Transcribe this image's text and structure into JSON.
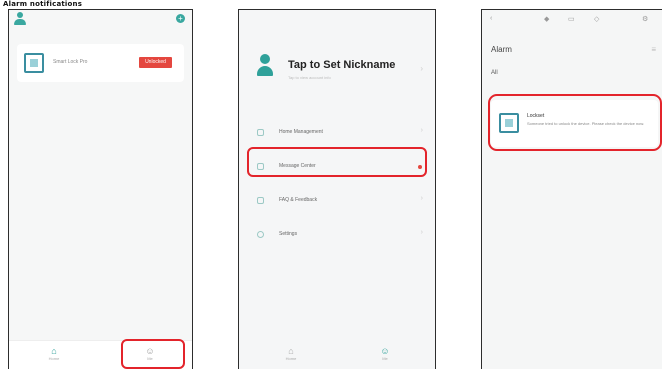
{
  "caption": "Alarm notifications",
  "phone1": {
    "device_name": "Smart Lock Pro",
    "device_badge": "Unlocked",
    "tabs": [
      {
        "label": "Home",
        "icon": "home-icon"
      },
      {
        "label": "Me",
        "icon": "me-icon"
      }
    ]
  },
  "phone2": {
    "title": "Tap to Set Nickname",
    "subtitle": "Tap to view account info",
    "menu": [
      {
        "label": "Home Management",
        "icon": "home-icon"
      },
      {
        "label": "Message Center",
        "icon": "message-icon",
        "has_badge": true
      },
      {
        "label": "FAQ & Feedback",
        "icon": "feedback-icon"
      },
      {
        "label": "Settings",
        "icon": "gear-icon"
      }
    ],
    "tabs": [
      {
        "label": "Home",
        "icon": "home-icon"
      },
      {
        "label": "Me",
        "icon": "me-icon"
      }
    ]
  },
  "phone3": {
    "title": "Alarm",
    "filter": "All",
    "alarm": {
      "name": "Lockset",
      "text": "Someone tried to unlock the device. Please check the device now."
    }
  },
  "colors": {
    "accent": "#2fa19a",
    "highlight": "#e3242b",
    "badge": "#e4473f"
  }
}
